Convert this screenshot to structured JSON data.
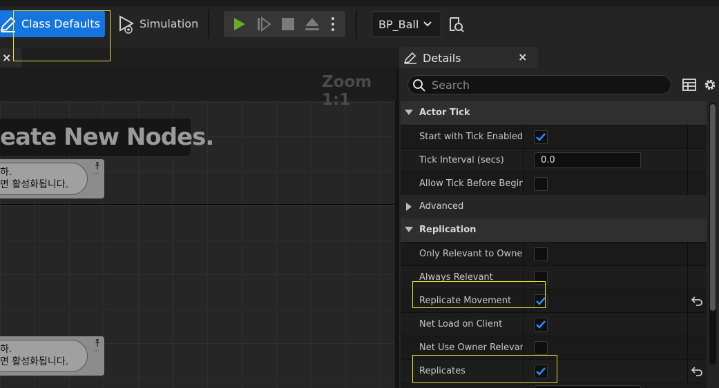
{
  "toolbar": {
    "class_defaults_label": "Class Defaults",
    "simulation_label": "Simulation",
    "blueprint_selector_value": "BP_Ball"
  },
  "graph": {
    "zoom_label": "Zoom 1:1",
    "hint_text": "eate New Nodes.",
    "comments": [
      {
        "line1": "하.",
        "line2": "면 활성화됩니다."
      },
      {
        "line1": "하.",
        "line2": "면 활성화됩니다."
      }
    ]
  },
  "details": {
    "tab_label": "Details",
    "search_placeholder": "Search",
    "rows": [
      {
        "kind": "category",
        "label": "Actor Tick",
        "expanded": true
      },
      {
        "kind": "bool",
        "label": "Start with Tick Enabled",
        "checked": true
      },
      {
        "kind": "number",
        "label": "Tick Interval (secs)",
        "value": "0.0"
      },
      {
        "kind": "bool",
        "label": "Allow Tick Before Begin...",
        "checked": false
      },
      {
        "kind": "category",
        "label": "Advanced",
        "expanded": false
      },
      {
        "kind": "category",
        "label": "Replication",
        "expanded": true
      },
      {
        "kind": "bool",
        "label": "Only Relevant to Owner",
        "checked": false
      },
      {
        "kind": "bool",
        "label": "Always Relevant",
        "checked": false
      },
      {
        "kind": "bool",
        "label": "Replicate Movement",
        "checked": true,
        "reset": true
      },
      {
        "kind": "bool",
        "label": "Net Load on Client",
        "checked": true
      },
      {
        "kind": "bool",
        "label": "Net Use Owner Relevancy",
        "checked": false
      },
      {
        "kind": "bool",
        "label": "Replicates",
        "checked": true,
        "reset": true
      }
    ]
  },
  "colors": {
    "accent": "#1575e0",
    "play_green": "#6aaa2a",
    "checkbox_check": "#2b8cff",
    "highlight": "#e8e23a"
  }
}
